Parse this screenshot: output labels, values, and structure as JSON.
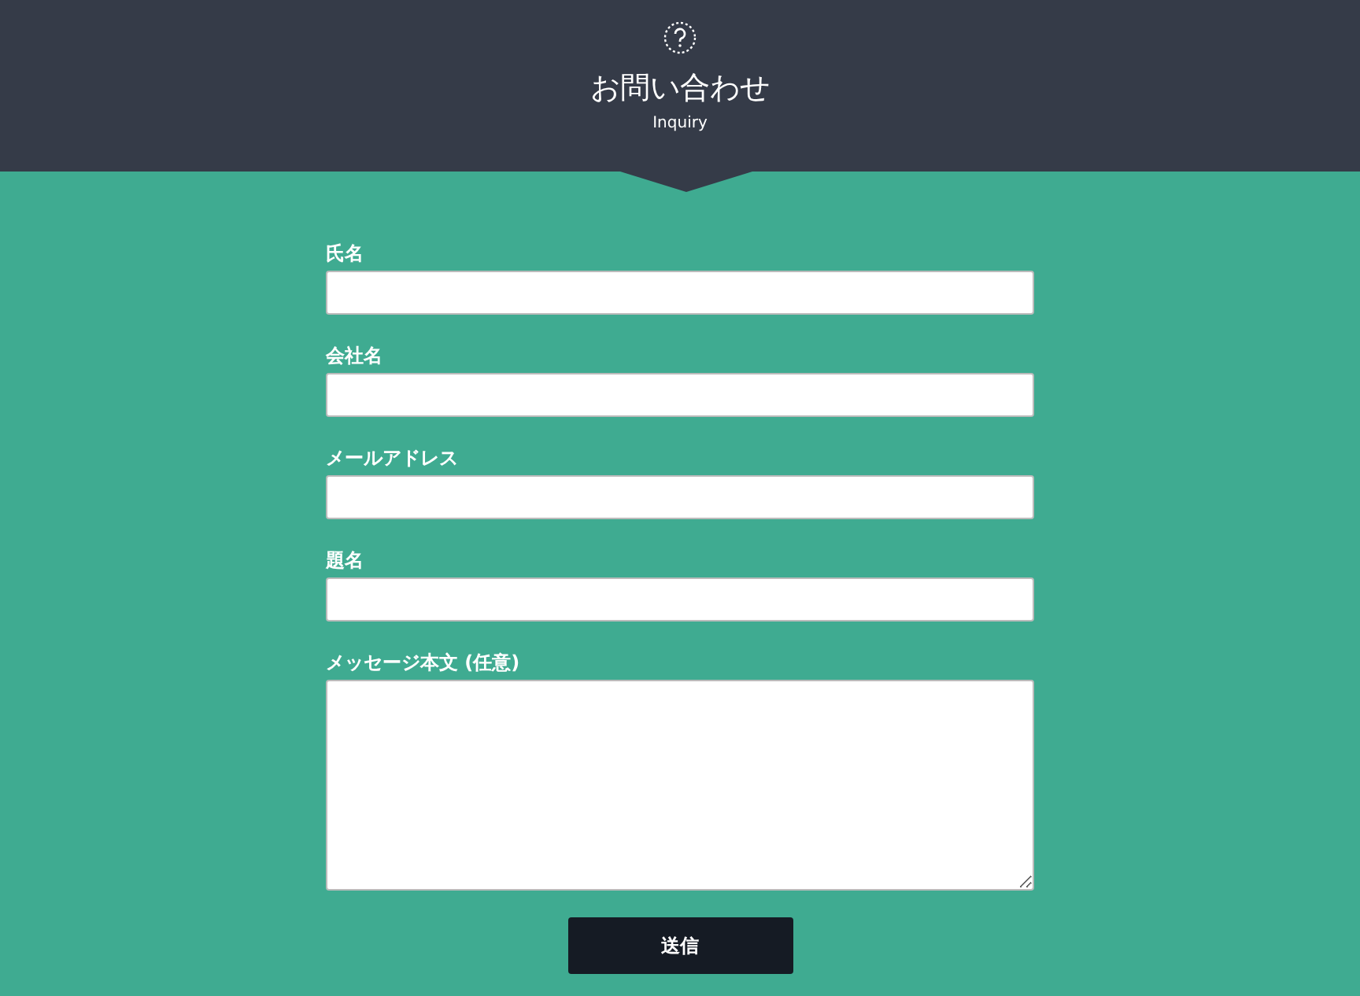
{
  "header": {
    "title": "お問い合わせ",
    "subtitle": "Inquiry"
  },
  "fields": [
    {
      "label": "氏名",
      "kind": "text"
    },
    {
      "label": "会社名",
      "kind": "text"
    },
    {
      "label": "メールアドレス",
      "kind": "text"
    },
    {
      "label": "題名",
      "kind": "text"
    },
    {
      "label": "メッセージ本文 (任意)",
      "kind": "textarea"
    }
  ],
  "submit": "送信"
}
